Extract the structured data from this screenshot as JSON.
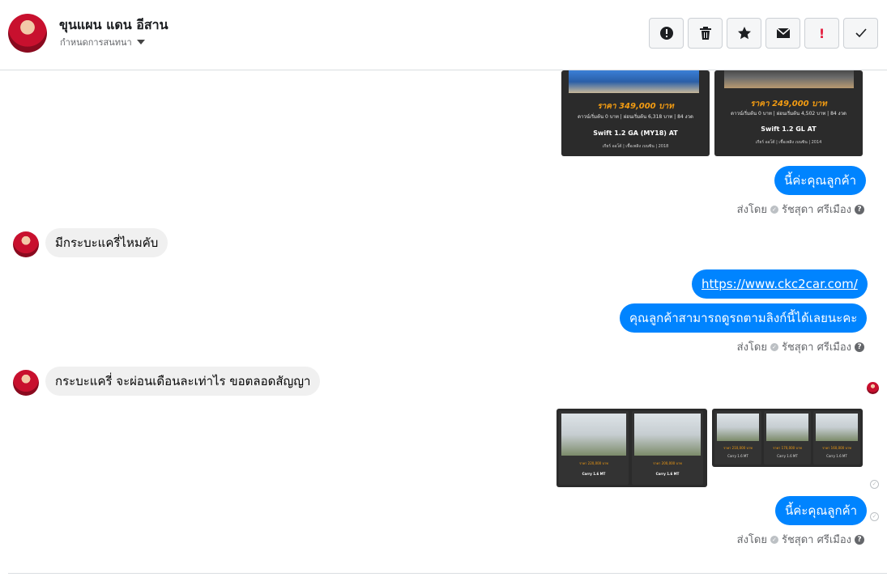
{
  "header": {
    "contact_name": "ขุนแผน แดน อีสาน",
    "subtitle": "กำหนดการสนทนา",
    "icons": [
      "alert-circle-icon",
      "trash-icon",
      "star-icon",
      "mail-icon",
      "exclamation-icon",
      "check-icon"
    ],
    "exclamation_glyph": "!"
  },
  "cards_top": [
    {
      "price": "ราคา 349,000 บาท",
      "terms": "ดาวน์เริ่มต้น 0 บาท | ผ่อนเริ่มต้น 6,318 บาท | 84 งวด",
      "model": "Swift 1.2 GA (MY18) AT",
      "foot": "เกียร์ ออโต้ | เชื้อเพลิง เบนซิน | 2018"
    },
    {
      "price": "ราคา 249,000 บาท",
      "terms": "ดาวน์เริ่มต้น 0 บาท | ผ่อนเริ่มต้น 4,502 บาท | 84 งวด",
      "model": "Swift 1.2 GL AT",
      "foot": "เกียร์ ออโต้ | เชื้อเพลิง เบนซิน | 2014"
    }
  ],
  "cards_bottom_large": [
    {
      "price": "ราคา 220,000 บาท",
      "model": "Carry 1.6 MT"
    },
    {
      "price": "ราคา 200,000 บาท",
      "model": "Carry 1.6 MT"
    }
  ],
  "cards_bottom_small": [
    {
      "price": "ราคา 210,000 บาท",
      "model": "Carry 1.6 MT"
    },
    {
      "price": "ราคา 170,000 บาท",
      "model": "Carry 1.6 MT"
    },
    {
      "price": "ราคา 160,000 บาท",
      "model": "Carry 1.6 MT"
    }
  ],
  "messages": {
    "out1": "นี้ค่ะคุณลูกค้า",
    "sent_by_label": "ส่งโดย",
    "sent_by_name": "รัชสุดา ศรีเมือง",
    "in1": "มีกระบะแครี่ไหมคับ",
    "out_link": "https://www.ckc2car.com/",
    "out2": "คุณลูกค้าสามารถดูรถตามลิงก์นี้ได้เลยนะคะ",
    "in2": "กระบะแครี่ จะผ่อนเดือนละเท่าไร  ขอตลอดสัญญา",
    "out3": "นี้ค่ะคุณลูกค้า"
  }
}
